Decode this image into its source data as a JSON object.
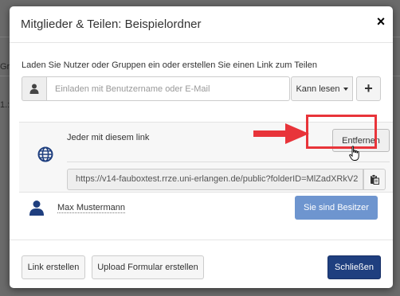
{
  "background": {
    "fragment_1": "Gr",
    "fragment_2": "1.:"
  },
  "dialog": {
    "title": "Mitglieder & Teilen: Beispielordner",
    "close_glyph": "×",
    "intro": "Laden Sie Nutzer oder Gruppen ein oder erstellen Sie einen Link zum Teilen",
    "invite": {
      "placeholder": "Einladen mit Benutzername oder E-Mail",
      "permission_label": "Kann lesen",
      "add_glyph": "+"
    },
    "public_link": {
      "label": "Jeder mit diesem link",
      "remove_label": "Entfernen",
      "url": "https://v14-fauboxtest.rrze.uni-erlangen.de/public?folderID=MlZadXRkV2"
    },
    "owner": {
      "name": "Max Mustermann",
      "role_label": "Sie sind Besitzer"
    },
    "footer": {
      "create_link_label": "Link erstellen",
      "upload_form_label": "Upload Formular erstellen",
      "close_label": "Schließen"
    }
  },
  "colors": {
    "highlight": "#e8343a",
    "owner_button": "#6e95cf",
    "primary": "#1f3f7f",
    "icon_blue": "#1f3f7f"
  },
  "icons": {
    "user": "user-icon",
    "globe": "globe-icon",
    "copy": "clipboard-icon",
    "owner": "person-icon",
    "annotation_arrow": "arrow-right-icon",
    "pointer": "hand-cursor-icon"
  }
}
